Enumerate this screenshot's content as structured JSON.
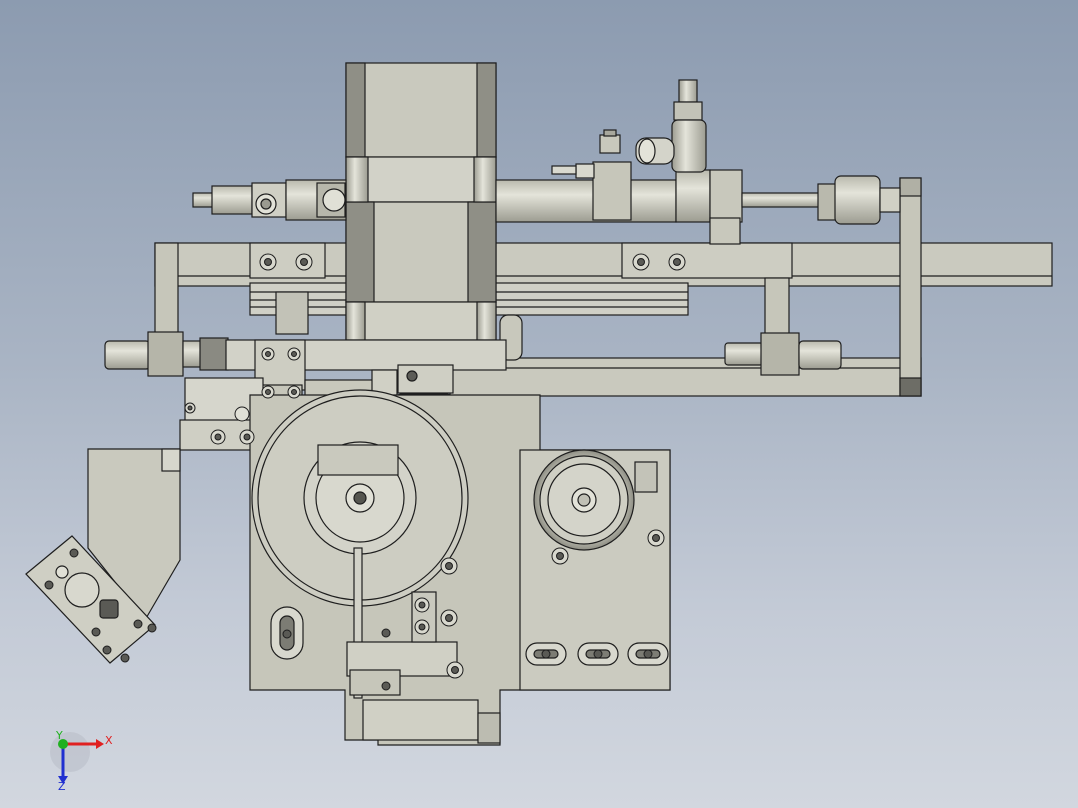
{
  "viewport": {
    "background_top": "#8c9bb0",
    "background_bottom": "#d2d7df",
    "part_fill": "#c8c8bc",
    "part_fill_light": "#d6d6cc",
    "part_fill_dark": "#a7a79c",
    "edge_color": "#1e1e1e",
    "screw_fill": "#5a5a55"
  },
  "triad": {
    "x_label": "X",
    "y_label": "Y",
    "z_label": "Z",
    "x_color": "#e02020",
    "y_color": "#20b020",
    "z_color": "#2030d0"
  }
}
